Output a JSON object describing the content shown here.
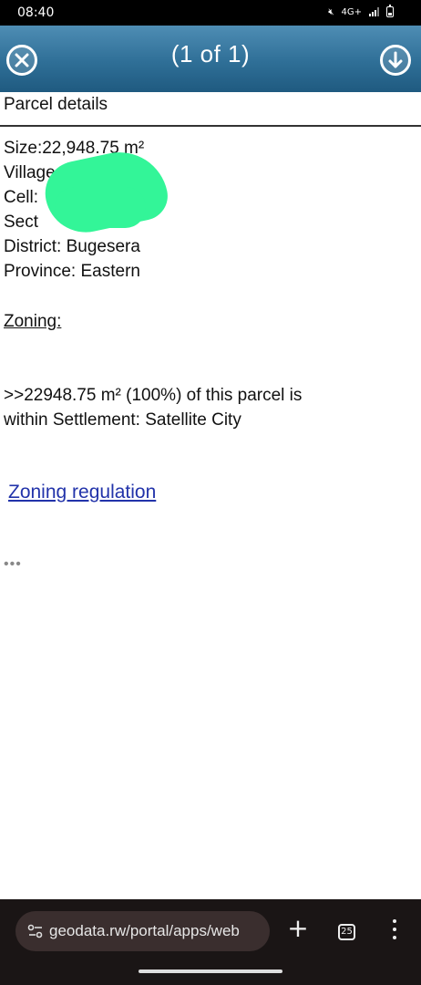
{
  "status_bar": {
    "time": "08:40",
    "network": "4G+"
  },
  "header": {
    "title": "(1 of 1)",
    "close_icon": "close-circle-icon",
    "download_icon": "download-circle-icon",
    "background_color": "#2f6f97"
  },
  "panel": {
    "title": "Parcel details",
    "size": "Size:22,948.75 m²",
    "village_label": "Village",
    "cell_label": "Cell:",
    "sector_label": "Sect",
    "district": "District: Bugesera",
    "province": "Province: Eastern",
    "zoning_label": "Zoning:",
    "zoning_line1": ">>22948.75 m² (100%) of this parcel is",
    "zoning_line2": "within Settlement: Satellite City",
    "zoning_link": "Zoning regulation",
    "more": "•••"
  },
  "browser": {
    "url": "geodata.rw/portal/apps/web",
    "tab_count": "25",
    "new_tab_label": "+"
  },
  "colors": {
    "link": "#2233aa",
    "redaction": "#33f598"
  }
}
